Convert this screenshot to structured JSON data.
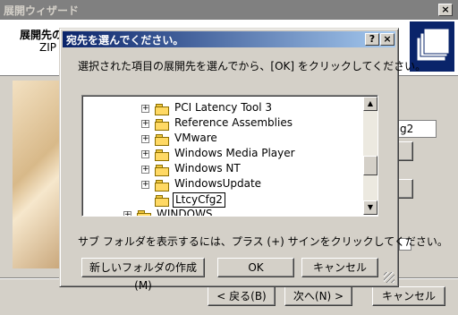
{
  "wizard": {
    "title": "展開ウィザード",
    "header_title": "展開先の",
    "header_sub": "ZIP",
    "right_edge_text": "g2",
    "buttons": {
      "back": "< 戻る(B)",
      "next": "次へ(N) >",
      "cancel": "キャンセル"
    }
  },
  "dialog": {
    "title": "宛先を選んでください。",
    "instruction": "選択された項目の展開先を選んでから、[OK] をクリックしてください。",
    "hint": "サブ フォルダを表示するには、プラス (+) サインをクリックしてください。",
    "tree": [
      {
        "label": "PCI Latency Tool 3",
        "expander": "+"
      },
      {
        "label": "Reference Assemblies",
        "expander": "+"
      },
      {
        "label": "VMware",
        "expander": "+"
      },
      {
        "label": "Windows Media Player",
        "expander": "+"
      },
      {
        "label": "Windows NT",
        "expander": "+"
      },
      {
        "label": "WindowsUpdate",
        "expander": "+"
      },
      {
        "label": "LtcyCfg2",
        "expander": ""
      },
      {
        "label": "WINDOWS",
        "expander": "+"
      }
    ],
    "buttons": {
      "new_folder": "新しいフォルダの作成(M)",
      "ok": "OK",
      "cancel": "キャンセル"
    },
    "title_buttons": {
      "help": "?",
      "close": "×"
    }
  },
  "colors": {
    "titlebar_active": "#0a246a",
    "titlebar_inactive": "#808080",
    "selection_outline": "#000000"
  }
}
